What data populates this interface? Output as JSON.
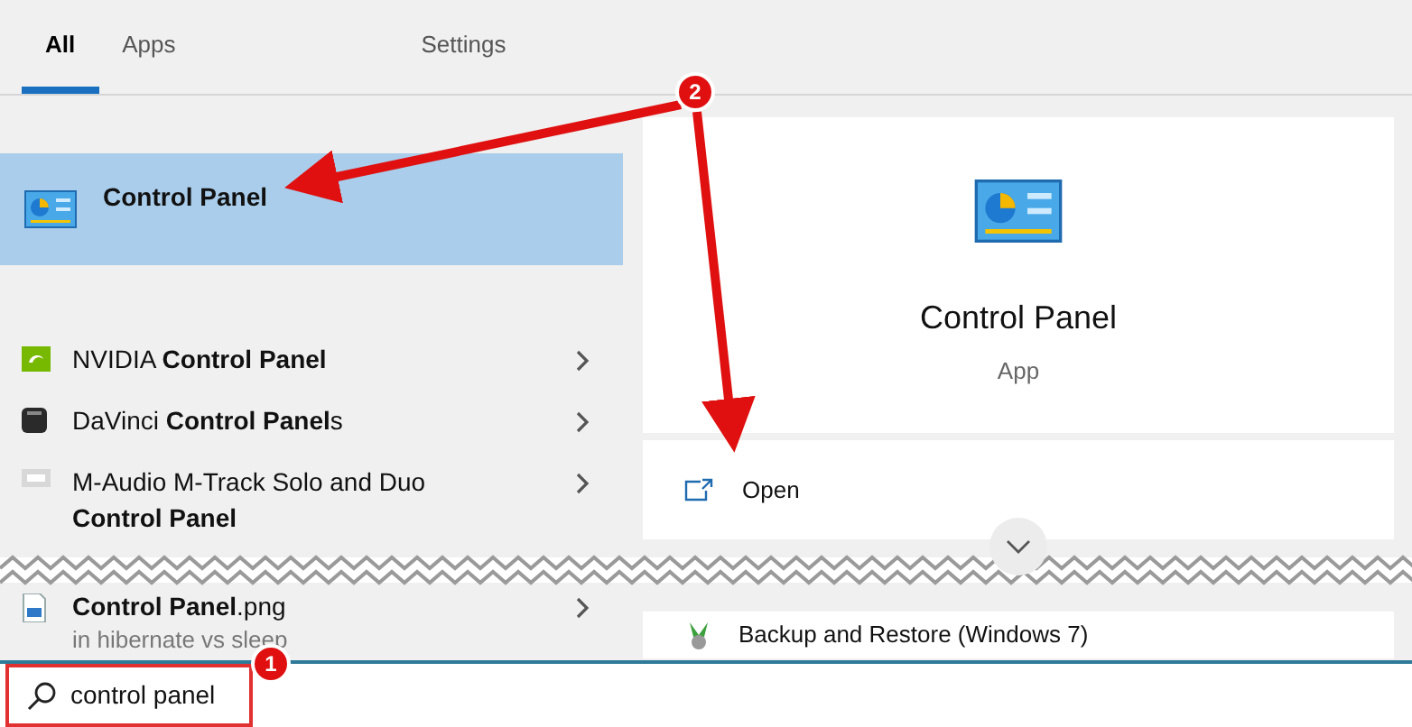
{
  "tabs": [
    {
      "label": "All",
      "selected": true
    },
    {
      "label": "Apps",
      "selected": false
    },
    {
      "label": "Settings",
      "selected": false
    }
  ],
  "best_match": {
    "title": "Control Panel",
    "selected": true
  },
  "results": [
    {
      "text": "NVIDIA **Control Panel**"
    },
    {
      "text": "DaVinci **Control Panel**s"
    },
    {
      "text": "M-Audio M-Track Solo and Duo **Control Panel**"
    },
    {
      "text": "**Control Panel**.png",
      "note": "in hibernate vs sleep"
    }
  ],
  "detail": {
    "title": "Control Panel",
    "type": "App",
    "actions": [
      {
        "label": "Open"
      }
    ],
    "related": [
      {
        "label": "Backup and Restore (Windows 7)"
      }
    ]
  },
  "search": {
    "value": "control panel"
  },
  "annotations": [
    {
      "number": "1"
    },
    {
      "number": "2"
    }
  ]
}
